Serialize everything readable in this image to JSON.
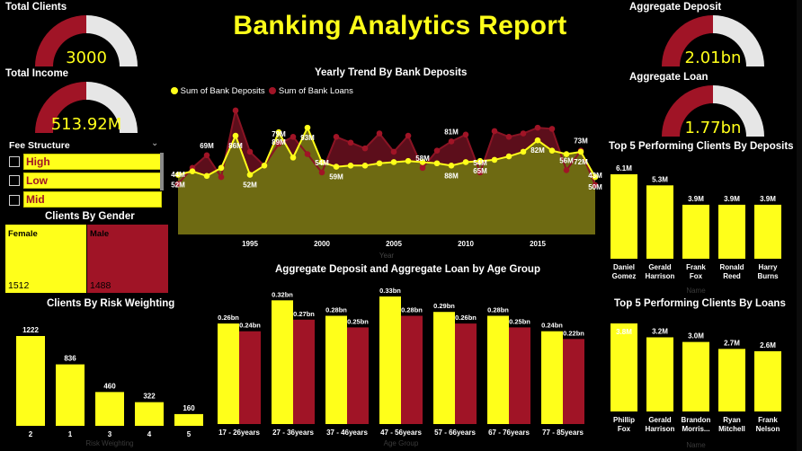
{
  "title": "Banking Analytics Report",
  "colors": {
    "yellow": "#ffff1a",
    "red": "#a01426",
    "grey": "#e6e6e6"
  },
  "gauges": [
    {
      "id": "total-clients",
      "title": "Total Clients",
      "value": "3000",
      "fill": 0.5
    },
    {
      "id": "total-income",
      "title": "Total Income",
      "value": "513.92M",
      "fill": 0.5
    },
    {
      "id": "aggregate-deposit",
      "title": "Aggregate Deposit",
      "value": "2.01bn",
      "fill": 0.5
    },
    {
      "id": "aggregate-loan",
      "title": "Aggregate Loan",
      "value": "1.77bn",
      "fill": 0.5
    }
  ],
  "fee_structure": {
    "title": "Fee Structure",
    "options": [
      "High",
      "Low",
      "Mid"
    ]
  },
  "gender": {
    "title": "Clients By Gender",
    "items": [
      {
        "label": "Female",
        "count": "1512"
      },
      {
        "label": "Male",
        "count": "1488"
      }
    ]
  },
  "chart_data": [
    {
      "id": "yearly-trend",
      "type": "area",
      "title": "Yearly Trend By Bank Deposits",
      "xlabel": "Year",
      "x_ticks": [
        "1995",
        "2000",
        "2005",
        "2010",
        "2015"
      ],
      "x_range": [
        1990,
        2019
      ],
      "ylim": [
        0,
        115
      ],
      "legend": "top-left",
      "series": [
        {
          "name": "Sum of Bank Deposits",
          "color": "#ffff1a",
          "x": [
            1990,
            1991,
            1992,
            1993,
            1994,
            1995,
            1996,
            1997,
            1998,
            1999,
            2000,
            2001,
            2002,
            2003,
            2004,
            2005,
            2006,
            2007,
            2008,
            2009,
            2010,
            2011,
            2012,
            2013,
            2014,
            2015,
            2016,
            2017,
            2018,
            2019
          ],
          "values": [
            52,
            55,
            51,
            58,
            86,
            52,
            60,
            89,
            67,
            93,
            63,
            59,
            60,
            60,
            62,
            63,
            64,
            63,
            62,
            60,
            63,
            64,
            65,
            68,
            72,
            82,
            73,
            70,
            72,
            50
          ]
        },
        {
          "name": "Sum of Bank Loans",
          "color": "#a01426",
          "x": [
            1990,
            1991,
            1992,
            1993,
            1994,
            1995,
            1996,
            1997,
            1998,
            1999,
            2000,
            2001,
            2002,
            2003,
            2004,
            2005,
            2006,
            2007,
            2008,
            2009,
            2010,
            2011,
            2012,
            2013,
            2014,
            2015,
            2016,
            2017,
            2018,
            2019
          ],
          "values": [
            44,
            58,
            69,
            50,
            108,
            72,
            60,
            79,
            85,
            70,
            54,
            85,
            80,
            75,
            88,
            72,
            86,
            58,
            73,
            81,
            87,
            54,
            90,
            85,
            88,
            93,
            92,
            56,
            73,
            43
          ]
        }
      ],
      "data_labels": [
        {
          "text": "52M",
          "series": 0,
          "i": 0
        },
        {
          "text": "86M",
          "series": 0,
          "i": 4
        },
        {
          "text": "52M",
          "series": 0,
          "i": 5
        },
        {
          "text": "89M",
          "series": 0,
          "i": 7
        },
        {
          "text": "93M",
          "series": 0,
          "i": 9
        },
        {
          "text": "59M",
          "series": 0,
          "i": 11
        },
        {
          "text": "88M",
          "series": 0,
          "i": 19
        },
        {
          "text": "65M",
          "series": 0,
          "i": 21
        },
        {
          "text": "82M",
          "series": 0,
          "i": 25
        },
        {
          "text": "72M",
          "series": 0,
          "i": 28
        },
        {
          "text": "50M",
          "series": 0,
          "i": 29
        },
        {
          "text": "44M",
          "series": 1,
          "i": 0
        },
        {
          "text": "69M",
          "series": 1,
          "i": 2
        },
        {
          "text": "79M",
          "series": 1,
          "i": 7
        },
        {
          "text": "54M",
          "series": 1,
          "i": 10
        },
        {
          "text": "58M",
          "series": 1,
          "i": 17
        },
        {
          "text": "81M",
          "series": 1,
          "i": 19
        },
        {
          "text": "54M",
          "series": 1,
          "i": 21
        },
        {
          "text": "56M",
          "series": 1,
          "i": 27
        },
        {
          "text": "73M",
          "series": 1,
          "i": 28
        },
        {
          "text": "43M",
          "series": 1,
          "i": 29
        }
      ]
    },
    {
      "id": "risk-weighting",
      "type": "bar",
      "title": "Clients By Risk Weighting",
      "xlabel": "Risk Weighting",
      "categories": [
        "2",
        "1",
        "3",
        "4",
        "5"
      ],
      "values": [
        1222,
        836,
        460,
        322,
        160
      ],
      "labels": [
        "1222",
        "836",
        "460",
        "322",
        "160"
      ],
      "ylim": [
        0,
        1222
      ],
      "color": "#ffff1a"
    },
    {
      "id": "age-group",
      "type": "bar",
      "title": "Aggregate Deposit and Aggregate Loan by Age Group",
      "xlabel": "Age Group",
      "categories": [
        "17 - 26years",
        "27 - 36years",
        "37 - 46years",
        "47 - 56years",
        "57 - 66years",
        "67 - 76years",
        "77 - 85years"
      ],
      "ylim": [
        0,
        0.33
      ],
      "series": [
        {
          "name": "Aggregate Deposit",
          "color": "#ffff1a",
          "values": [
            0.26,
            0.32,
            0.28,
            0.33,
            0.29,
            0.28,
            0.24
          ],
          "labels": [
            "0.26bn",
            "0.32bn",
            "0.28bn",
            "0.33bn",
            "0.29bn",
            "0.28bn",
            "0.24bn"
          ]
        },
        {
          "name": "Aggregate Loan",
          "color": "#a01426",
          "values": [
            0.24,
            0.27,
            0.25,
            0.28,
            0.26,
            0.25,
            0.22
          ],
          "labels": [
            "0.24bn",
            "0.27bn",
            "0.25bn",
            "0.28bn",
            "0.26bn",
            "0.25bn",
            "0.22bn"
          ]
        }
      ]
    },
    {
      "id": "top-deposits",
      "type": "bar",
      "title": "Top 5 Performing Clients By Deposits",
      "xlabel": "Name",
      "categories": [
        [
          "Daniel",
          "Gomez"
        ],
        [
          "Gerald",
          "Harrison"
        ],
        [
          "Frank",
          "Fox"
        ],
        [
          "Ronald",
          "Reed"
        ],
        [
          "Harry",
          "Burns"
        ]
      ],
      "values": [
        6.1,
        5.3,
        3.9,
        3.9,
        3.9
      ],
      "labels": [
        "6.1M",
        "5.3M",
        "3.9M",
        "3.9M",
        "3.9M"
      ],
      "ylim": [
        0,
        6.1
      ],
      "color": "#ffff1a"
    },
    {
      "id": "top-loans",
      "type": "bar",
      "title": "Top 5 Performing Clients By Loans",
      "xlabel": "Name",
      "categories": [
        [
          "Phillip",
          "Fox"
        ],
        [
          "Gerald",
          "Harrison"
        ],
        [
          "Brandon",
          "Morris..."
        ],
        [
          "Ryan",
          "Mitchell"
        ],
        [
          "Frank",
          "Nelson"
        ]
      ],
      "values": [
        3.8,
        3.2,
        3.0,
        2.7,
        2.6
      ],
      "labels": [
        "3.8M",
        "3.2M",
        "3.0M",
        "2.7M",
        "2.6M"
      ],
      "ylim": [
        0,
        3.8
      ],
      "color": "#ffff1a"
    }
  ]
}
